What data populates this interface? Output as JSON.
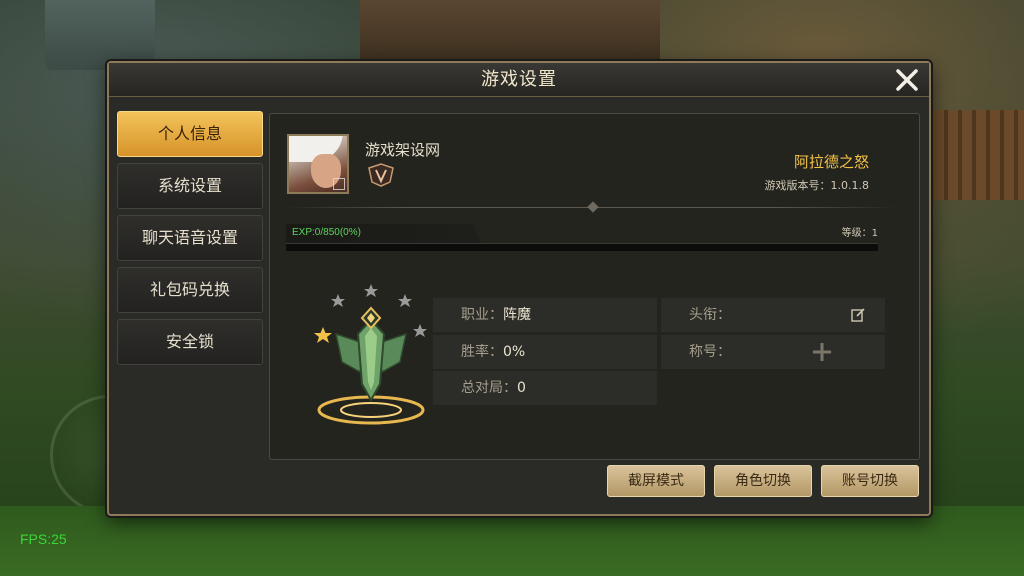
{
  "hud": {
    "fps": "FPS:25"
  },
  "dialog": {
    "title": "游戏设置",
    "menu": [
      {
        "label": "个人信息",
        "active": true
      },
      {
        "label": "系统设置",
        "active": false
      },
      {
        "label": "聊天语音设置",
        "active": false
      },
      {
        "label": "礼包码兑换",
        "active": false
      },
      {
        "label": "安全锁",
        "active": false
      }
    ],
    "profile": {
      "player_name": "游戏架设网",
      "server_name": "阿拉德之怒",
      "version": "游戏版本号：1.0.1.8",
      "exp_text": "EXP:0/850(0%)",
      "exp_fraction": 0,
      "level": "等级：1"
    },
    "stats": {
      "job_label": "职业：",
      "job_value": "阵魔",
      "winrate_label": "胜率：",
      "winrate_value": "0%",
      "matches_label": "总对局：",
      "matches_value": "0",
      "head_title_label": "头衔：",
      "nickname_label": "称号："
    },
    "buttons": {
      "screenshot_mode": "截屏模式",
      "switch_character": "角色切换",
      "switch_account": "账号切换"
    }
  },
  "colors": {
    "accent_gold": "#f2c147",
    "active_tab": "#e8a83a",
    "exp_green": "#5bd65b",
    "fps_green": "#38d638"
  }
}
